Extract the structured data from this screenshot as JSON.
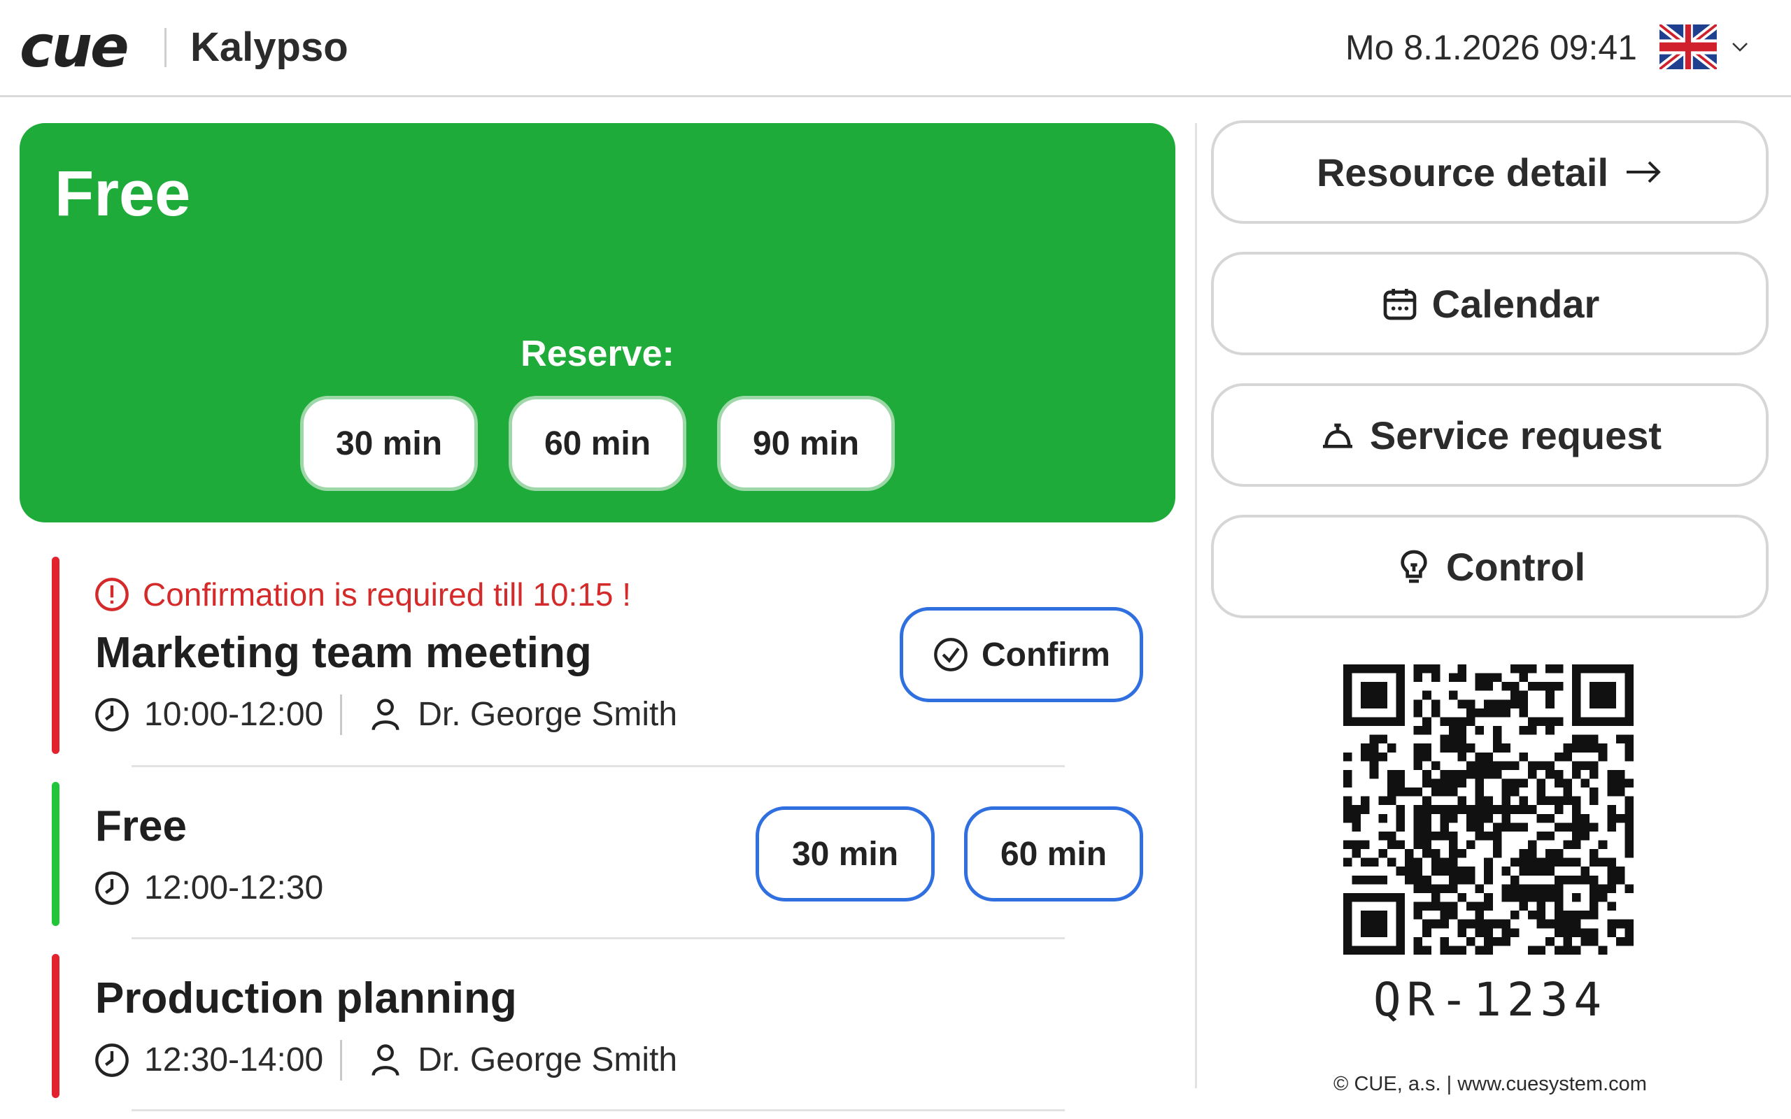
{
  "header": {
    "logo_text": "cue",
    "app_name": "Kalypso",
    "datetime": "Mo 8.1.2026 09:41",
    "language_flag": "uk-flag-icon"
  },
  "status": {
    "title": "Free",
    "reserve_label": "Reserve:",
    "reserve_options": [
      "30 min",
      "60 min",
      "90 min"
    ],
    "color": "#1fab3a"
  },
  "agenda": [
    {
      "alert": "Confirmation is required till 10:15 !",
      "title": "Marketing team meeting",
      "time": "10:00-12:00",
      "person": "Dr. George Smith",
      "action_label": "Confirm",
      "bar_color": "red"
    },
    {
      "title": "Free",
      "time": "12:00-12:30",
      "slot_options": [
        "30 min",
        "60 min"
      ],
      "bar_color": "green"
    },
    {
      "title": "Production planning",
      "time": "12:30-14:00",
      "person": "Dr. George Smith",
      "bar_color": "red"
    }
  ],
  "sidebar": {
    "resource_detail": "Resource detail",
    "calendar": "Calendar",
    "service_request": "Service request",
    "control": "Control"
  },
  "qr": {
    "label": "QR-1234"
  },
  "footer": {
    "text": "© CUE, a.s. | www.cuesystem.com"
  },
  "colors": {
    "free": "#1fab3a",
    "busy_bar": "#e2222d",
    "free_bar": "#22c43a",
    "alert": "#d42a2a",
    "accent_border": "#2f6fe0"
  }
}
